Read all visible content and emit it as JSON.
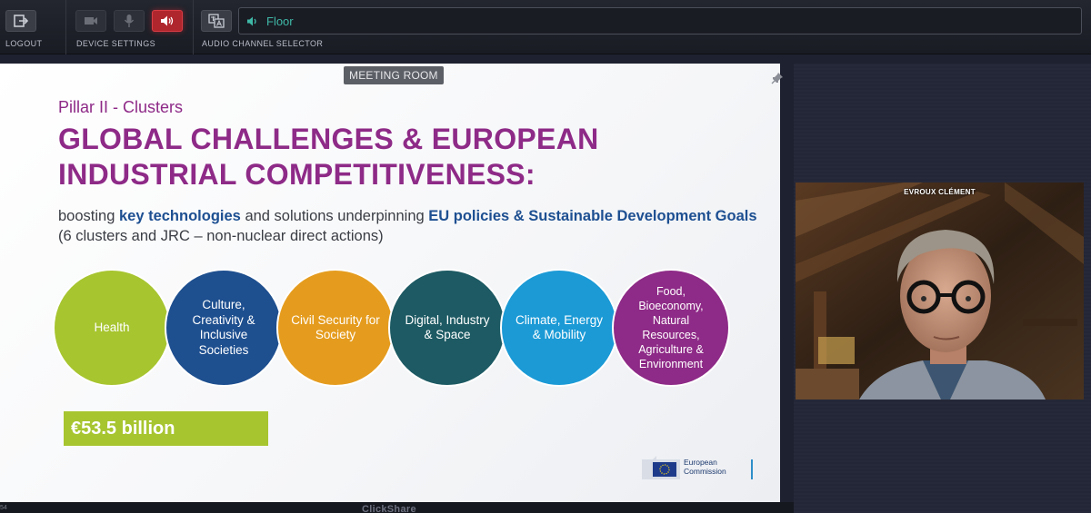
{
  "toolbar": {
    "logout_label": "LOGOUT",
    "device_settings_label": "DEVICE SETTINGS",
    "audio_channel_label": "AUDIO CHANNEL SELECTOR",
    "channel_value": "Floor"
  },
  "meeting_room_label": "MEETING ROOM",
  "slide": {
    "pillar": "Pillar II - Clusters",
    "headline_line1": "GLOBAL CHALLENGES & EUROPEAN",
    "headline_line2": "INDUSTRIAL COMPETITIVENESS:",
    "sub_part1": "boosting ",
    "sub_key1": "key technologies",
    "sub_part2": " and solutions underpinning ",
    "sub_key2": "EU policies & Sustainable Development Goals",
    "sub_part3": " (6 clusters and JRC – non-nuclear direct actions)",
    "clusters": [
      {
        "label": "Health",
        "color": "#a7c52f"
      },
      {
        "label": "Culture, Creativity & Inclusive Societies",
        "color": "#1e4f8f"
      },
      {
        "label": "Civil Security for Society",
        "color": "#e59c1e"
      },
      {
        "label": "Digital, Industry & Space",
        "color": "#1d5a63"
      },
      {
        "label": "Climate, Energy & Mobility",
        "color": "#1b9ad6"
      },
      {
        "label": "Food, Bioeconomy, Natural Resources, Agriculture & Environment",
        "color": "#8e2a87"
      }
    ],
    "budget": "€53.5 billion",
    "logo_line1": "European",
    "logo_line2": "Commission"
  },
  "video": {
    "participant_name": "EVROUX CLÉMENT"
  },
  "bottom": {
    "app_name": "ClickShare",
    "slide_number": "54"
  },
  "colors": {
    "headline": "#8e2a87",
    "key_blue": "#1d4f91",
    "channel_teal": "#3fb8a6",
    "mute_red": "#b0262d"
  }
}
